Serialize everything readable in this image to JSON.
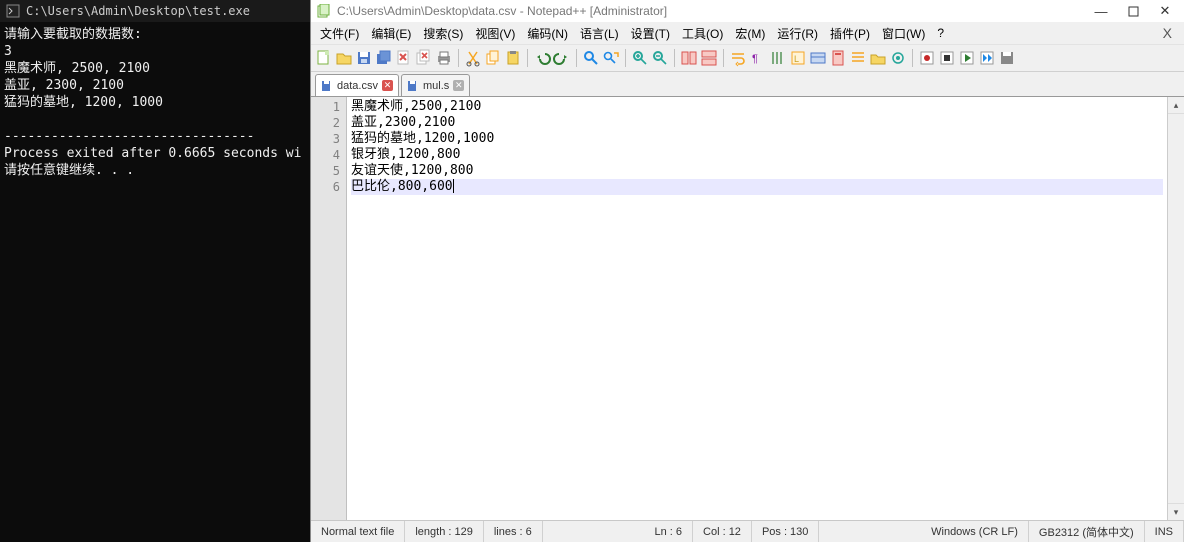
{
  "console": {
    "title": "C:\\Users\\Admin\\Desktop\\test.exe",
    "lines": [
      "请输入要截取的数据数:",
      "3",
      "黑魔术师, 2500, 2100",
      "盖亚, 2300, 2100",
      "猛犸的墓地, 1200, 1000",
      "",
      "--------------------------------",
      "Process exited after 0.6665 seconds wi",
      "请按任意键继续. . ."
    ]
  },
  "npp": {
    "title": "C:\\Users\\Admin\\Desktop\\data.csv - Notepad++ [Administrator]",
    "menus": [
      "文件(F)",
      "编辑(E)",
      "搜索(S)",
      "视图(V)",
      "编码(N)",
      "语言(L)",
      "设置(T)",
      "工具(O)",
      "宏(M)",
      "运行(R)",
      "插件(P)",
      "窗口(W)",
      "?"
    ],
    "tabs": [
      {
        "label": "data.csv",
        "active": true
      },
      {
        "label": "mul.s",
        "active": false
      }
    ],
    "code_lines": [
      "黑魔术师,2500,2100",
      "盖亚,2300,2100",
      "猛犸的墓地,1200,1000",
      "银牙狼,1200,800",
      "友谊天使,1200,800",
      "巴比伦,800,600"
    ],
    "line_numbers": [
      "1",
      "2",
      "3",
      "4",
      "5",
      "6"
    ],
    "status": {
      "filetype": "Normal text file",
      "length": "length : 129",
      "lines": "lines : 6",
      "ln": "Ln : 6",
      "col": "Col : 12",
      "pos": "Pos : 130",
      "eol": "Windows (CR LF)",
      "encoding": "GB2312 (简体中文)",
      "mode": "INS"
    },
    "toolbar_icons": [
      "new-file-icon",
      "open-file-icon",
      "save-icon",
      "save-all-icon",
      "close-icon",
      "close-all-icon",
      "print-icon",
      "sep",
      "cut-icon",
      "copy-icon",
      "paste-icon",
      "sep",
      "undo-icon",
      "redo-icon",
      "sep",
      "find-icon",
      "replace-icon",
      "sep",
      "zoom-in-icon",
      "zoom-out-icon",
      "sep",
      "sync-v-icon",
      "sync-h-icon",
      "sep",
      "wordwrap-icon",
      "all-chars-icon",
      "indent-guide-icon",
      "lang-icon",
      "folder-icon",
      "doc-map-icon",
      "func-list-icon",
      "sep",
      "monitor-icon",
      "sep",
      "record-icon",
      "stop-icon",
      "play-icon",
      "play-multi-icon",
      "save-macro-icon"
    ],
    "colors": {
      "new": "#7cb342",
      "open": "#f6c344",
      "save": "#4e79c7",
      "saveall": "#4e79c7",
      "close": "#d9534f",
      "closeall": "#d9534f",
      "print": "#888",
      "cut": "#f6a623",
      "copy": "#f6a623",
      "paste": "#f6a623",
      "undo": "#2e7d32",
      "redo": "#2e7d32",
      "find": "#1e88e5",
      "replace": "#1e88e5",
      "zoomin": "#26a69a",
      "zoomout": "#26a69a",
      "syncv": "#d9534f",
      "synch": "#d9534f",
      "wordwrap": "#f6a623",
      "allchars": "#8e24aa",
      "indent": "#2e7d32",
      "lang": "#f6a623",
      "folder": "#4e79c7",
      "docmap": "#d9534f",
      "funclist": "#f6a623",
      "monitor": "#26a69a",
      "record": "#c62828",
      "stop": "#333",
      "play": "#2e7d32",
      "playmulti": "#1e88e5",
      "savemacro": "#555"
    }
  },
  "watermark": ""
}
